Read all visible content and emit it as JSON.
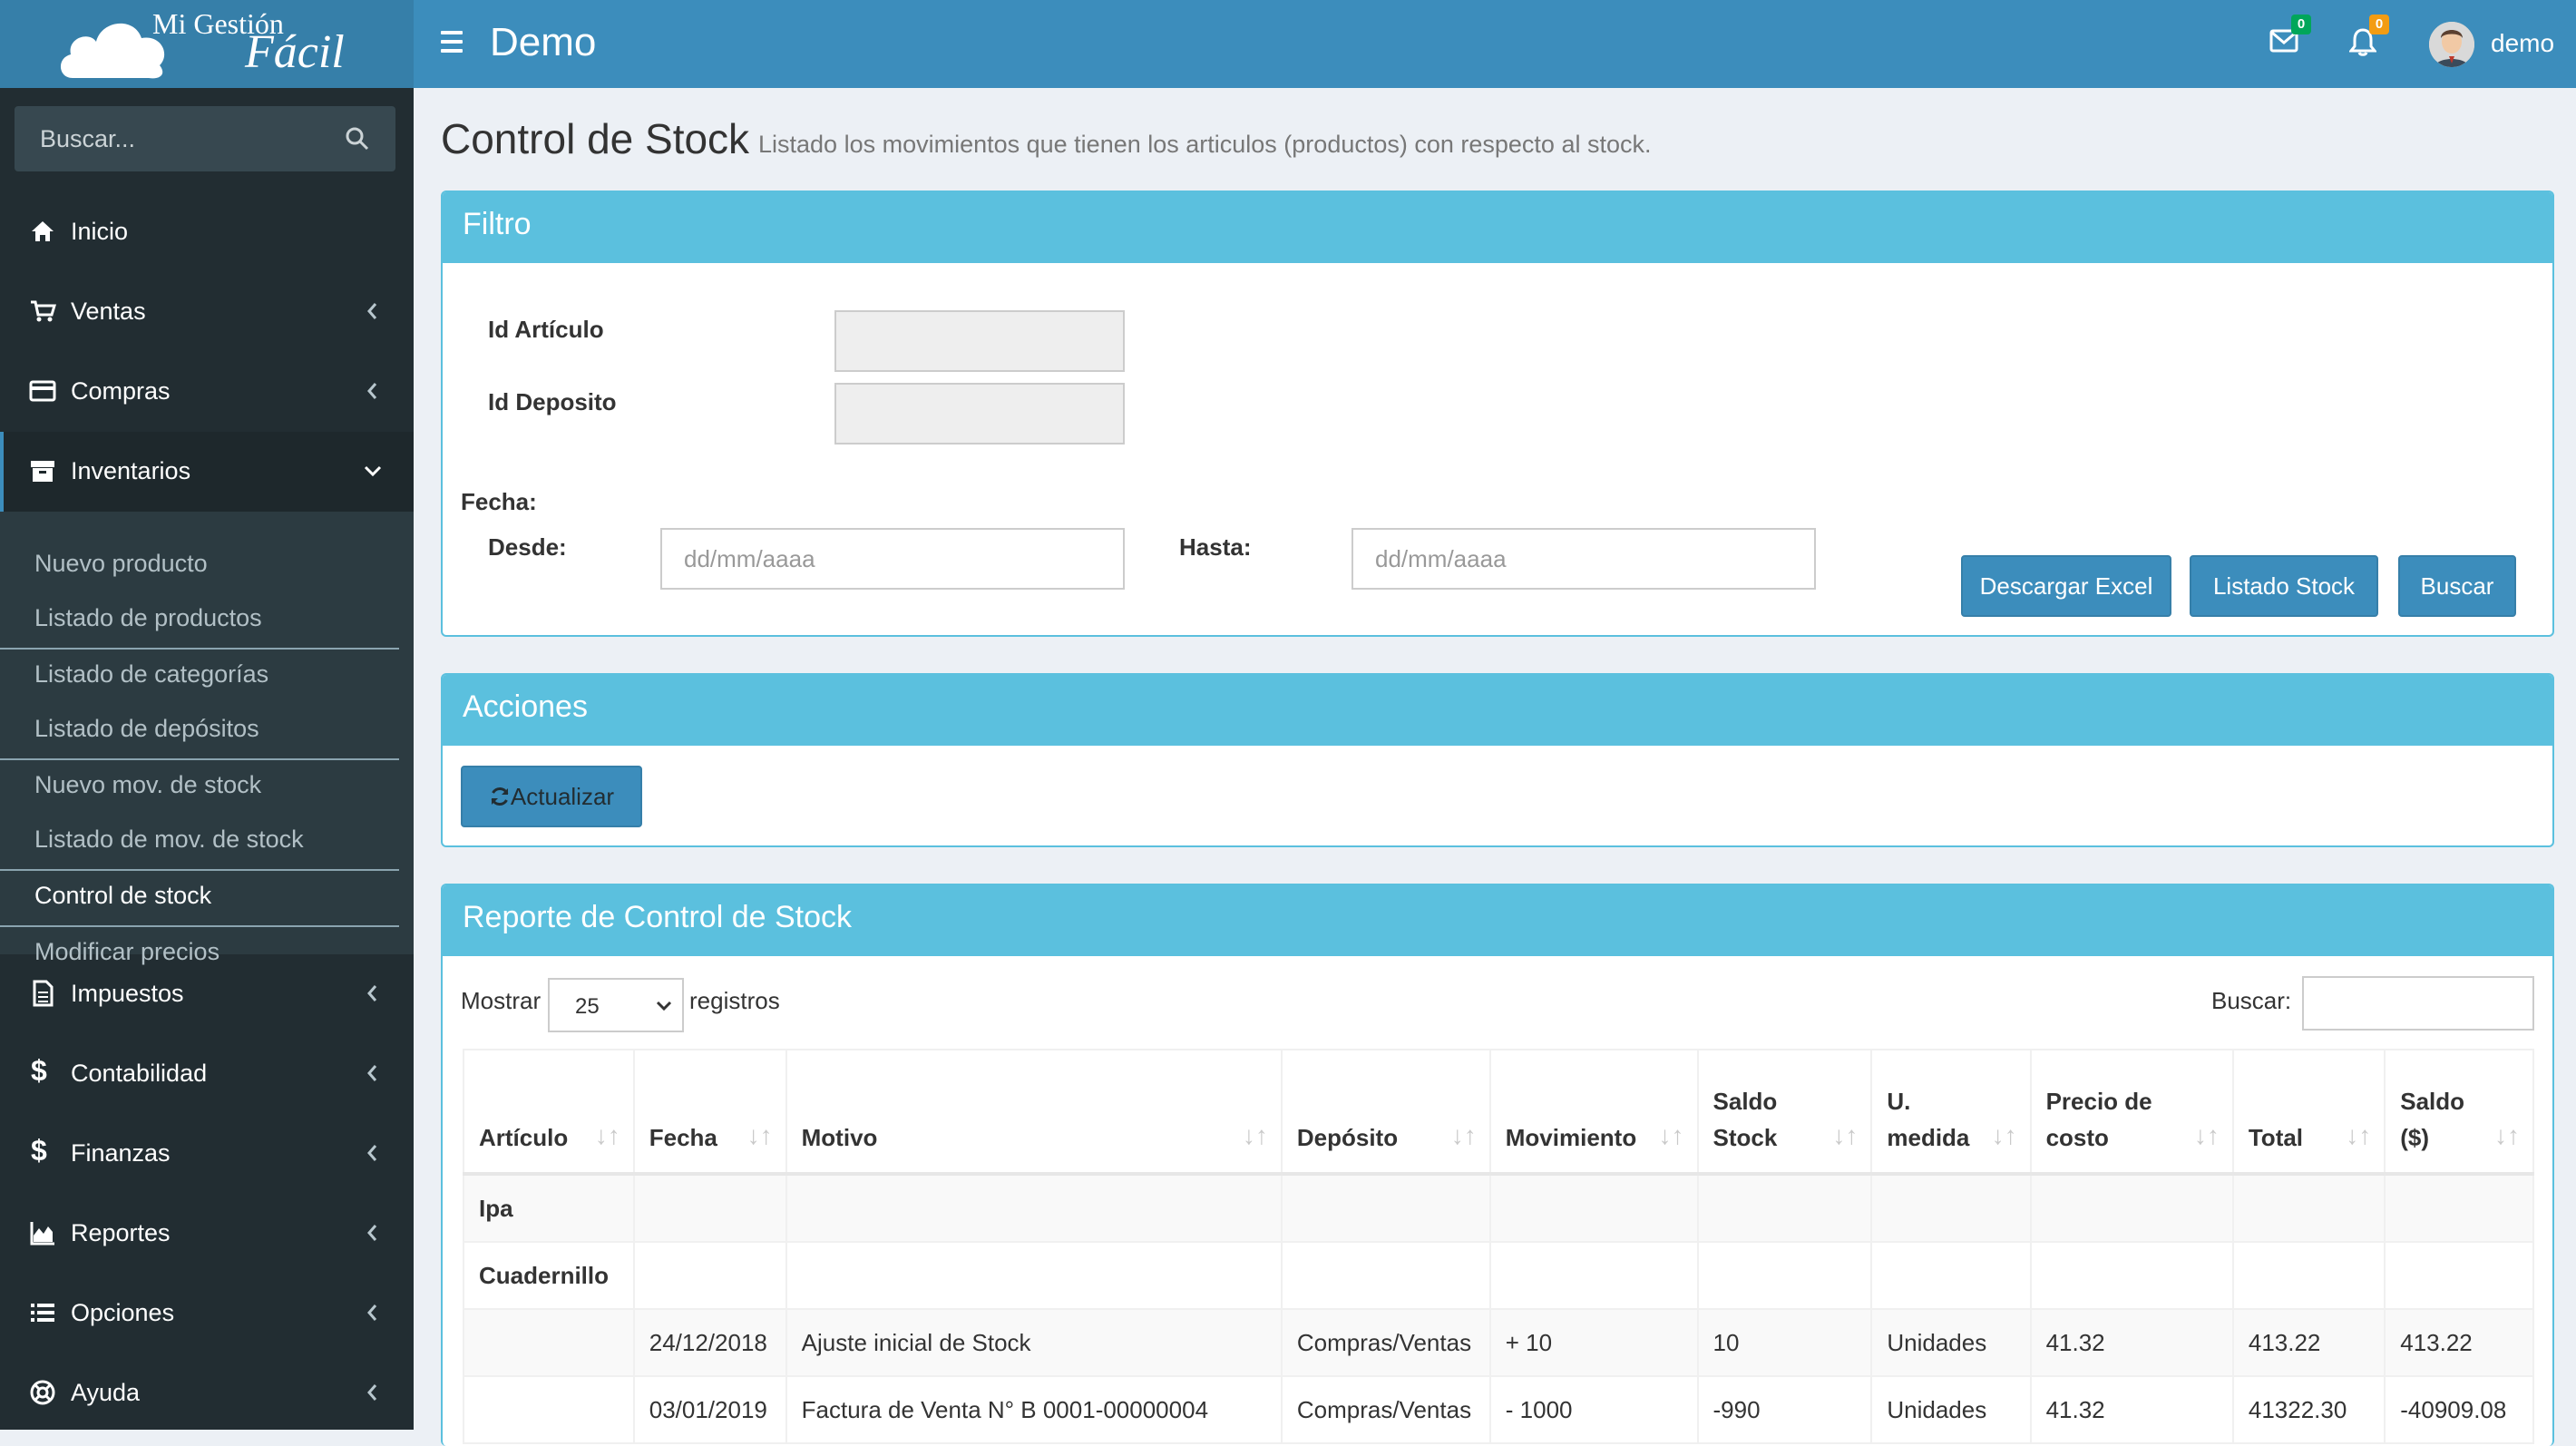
{
  "header": {
    "logo_line1": "Mi Gestión",
    "logo_line2": "Fácil",
    "app_title": "Demo",
    "messages_count": "0",
    "notifications_count": "0",
    "user_name": "demo"
  },
  "sidebar": {
    "search_placeholder": "Buscar...",
    "menu": [
      {
        "label": "Inicio",
        "icon": "home-icon"
      },
      {
        "label": "Ventas",
        "icon": "cart-icon"
      },
      {
        "label": "Compras",
        "icon": "credit-card-icon"
      },
      {
        "label": "Inventarios",
        "icon": "archive-icon"
      },
      {
        "label": "Impuestos",
        "icon": "file-icon"
      },
      {
        "label": "Contabilidad",
        "icon": "dollar-icon"
      },
      {
        "label": "Finanzas",
        "icon": "dollar-icon"
      },
      {
        "label": "Reportes",
        "icon": "area-chart-icon"
      },
      {
        "label": "Opciones",
        "icon": "list-icon"
      },
      {
        "label": "Ayuda",
        "icon": "lifebuoy-icon"
      }
    ],
    "submenu": [
      "Nuevo producto",
      "Listado de productos",
      "Listado de categorías",
      "Listado de depósitos",
      "Nuevo mov. de stock",
      "Listado de mov. de stock",
      "Control de stock",
      "Modificar precios"
    ]
  },
  "page": {
    "title": "Control de Stock",
    "subtitle": "Listado los movimientos que tienen los articulos (productos) con respecto al stock."
  },
  "filter": {
    "header": "Filtro",
    "id_articulo_label": "Id Artículo",
    "id_deposito_label": "Id Deposito",
    "fecha_label": "Fecha:",
    "desde_label": "Desde:",
    "hasta_label": "Hasta:",
    "date_placeholder": "dd/mm/aaaa",
    "btn_excel": "Descargar Excel",
    "btn_listado": "Listado Stock",
    "btn_buscar": "Buscar"
  },
  "actions": {
    "header": "Acciones",
    "btn_actualizar": "Actualizar"
  },
  "report": {
    "header": "Reporte de Control de Stock",
    "show_label": "Mostrar",
    "page_size": "25",
    "records_label": "registros",
    "search_label": "Buscar:",
    "columns": [
      [
        "Artículo"
      ],
      [
        "Fecha"
      ],
      [
        "Motivo"
      ],
      [
        "Depósito"
      ],
      [
        "Movimiento"
      ],
      [
        "Saldo",
        "Stock"
      ],
      [
        "U.",
        "medida"
      ],
      [
        "Precio de",
        "costo"
      ],
      [
        "Total"
      ],
      [
        "Saldo",
        "($)"
      ]
    ],
    "rows": [
      {
        "bold": true,
        "cells": [
          "Ipa",
          "",
          "",
          "",
          "",
          "",
          "",
          "",
          "",
          ""
        ]
      },
      {
        "bold": true,
        "cells": [
          "Cuadernillo",
          "",
          "",
          "",
          "",
          "",
          "",
          "",
          "",
          ""
        ]
      },
      {
        "bold": false,
        "cells": [
          "",
          "24/12/2018",
          "Ajuste inicial de Stock",
          "Compras/Ventas",
          "+ 10",
          "10",
          "Unidades",
          "41.32",
          "413.22",
          "413.22"
        ]
      },
      {
        "bold": false,
        "cells": [
          "",
          "03/01/2019",
          "Factura de Venta N° B 0001-00000004",
          "Compras/Ventas",
          "- 1000",
          "-990",
          "Unidades",
          "41.32",
          "41322.30",
          "-40909.08"
        ]
      }
    ]
  },
  "colors": {
    "header_bg": "#3c8dbc",
    "logo_bg": "#367fa9",
    "sidebar_bg": "#222d32",
    "box_header": "#5bc0de",
    "badge_green": "#00a65a",
    "badge_orange": "#f39c12"
  }
}
